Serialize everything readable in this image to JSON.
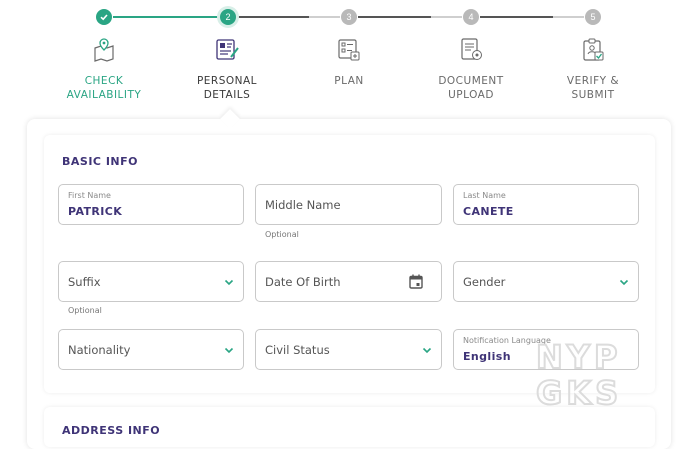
{
  "stepper": {
    "steps": [
      {
        "number": "1",
        "label_line1": "CHECK",
        "label_line2": "AVAILABILITY",
        "state": "done",
        "icon": "map-pin-icon"
      },
      {
        "number": "2",
        "label_line1": "PERSONAL",
        "label_line2": "DETAILS",
        "state": "active",
        "icon": "id-form-icon"
      },
      {
        "number": "3",
        "label_line1": "PLAN",
        "label_line2": "",
        "state": "pending",
        "icon": "plan-list-icon"
      },
      {
        "number": "4",
        "label_line1": "DOCUMENT",
        "label_line2": "UPLOAD",
        "state": "pending",
        "icon": "document-upload-icon"
      },
      {
        "number": "5",
        "label_line1": "VERIFY &",
        "label_line2": "SUBMIT",
        "state": "pending",
        "icon": "verify-clipboard-icon"
      }
    ]
  },
  "basic_info": {
    "title": "BASIC INFO",
    "first_name": {
      "label": "First Name",
      "value": "PATRICK"
    },
    "middle_name": {
      "placeholder": "Middle Name",
      "helper": "Optional"
    },
    "last_name": {
      "label": "Last Name",
      "value": "CANETE"
    },
    "suffix": {
      "placeholder": "Suffix",
      "helper": "Optional"
    },
    "date_of_birth": {
      "placeholder": "Date Of Birth"
    },
    "gender": {
      "placeholder": "Gender"
    },
    "nationality": {
      "placeholder": "Nationality"
    },
    "civil_status": {
      "placeholder": "Civil Status"
    },
    "notification_language": {
      "label": "Notification Language",
      "value": "English"
    }
  },
  "address_info": {
    "title": "ADDRESS INFO"
  },
  "watermark": {
    "line1": "NYP",
    "line2": "GKS"
  },
  "colors": {
    "accent": "#2aa584",
    "heading": "#3f3477",
    "pending": "#b9b9b9"
  }
}
